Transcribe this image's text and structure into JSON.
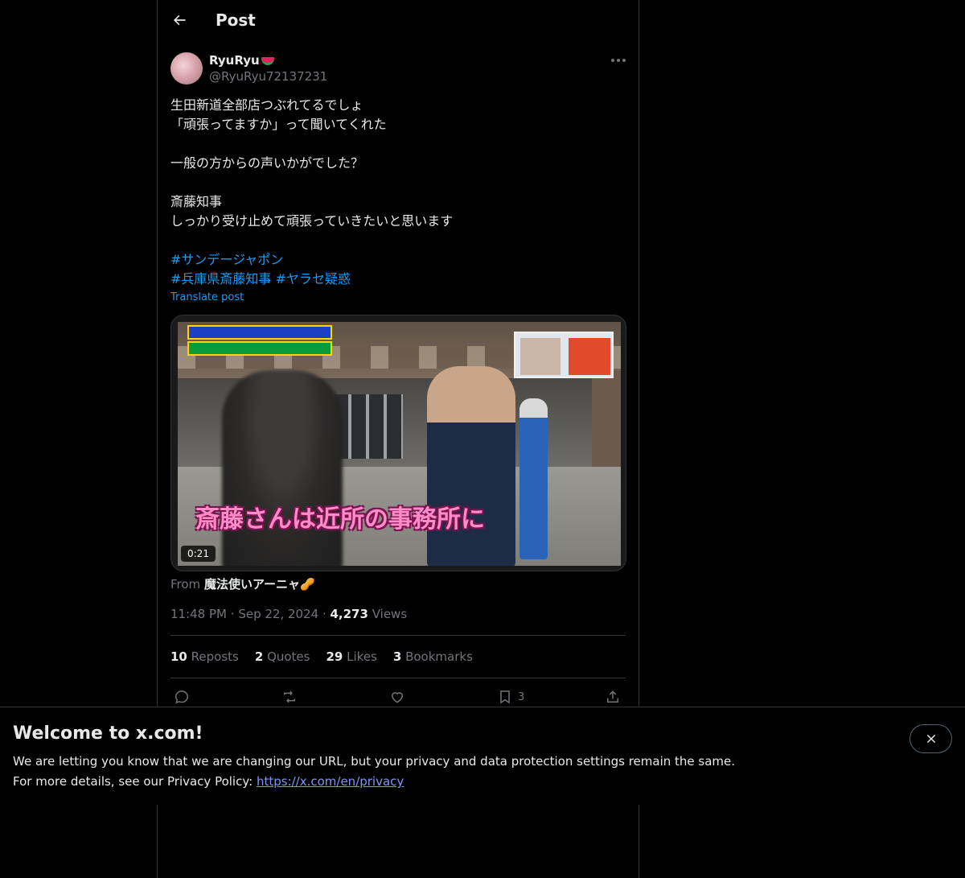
{
  "header": {
    "title": "Post"
  },
  "author": {
    "display_name": "RyuRyu",
    "handle": "@RyuRyu72137231"
  },
  "post": {
    "lines": [
      "生田新道全部店つぶれてるでしょ",
      "「頑張ってますか」って聞いてくれた",
      "",
      "一般の方からの声いかがでした？",
      "",
      "斎藤知事",
      "しっかり受け止めて頑張っていきたいと思います"
    ],
    "hashtags": {
      "row1": [
        "#サンデージャポン"
      ],
      "row2": [
        "#兵庫県斎藤知事",
        "#ヤラセ疑惑"
      ]
    },
    "translate_label": "Translate post"
  },
  "media": {
    "caption": "斎藤さんは近所の事務所に",
    "duration": "0:21"
  },
  "from": {
    "label": "From",
    "name": "魔法使いアーニャ🥜"
  },
  "meta": {
    "time": "11:48 PM",
    "date": "Sep 22, 2024",
    "views_count": "4,273",
    "views_label": "Views"
  },
  "stats": {
    "reposts": {
      "count": "10",
      "label": "Reposts"
    },
    "quotes": {
      "count": "2",
      "label": "Quotes"
    },
    "likes": {
      "count": "29",
      "label": "Likes"
    },
    "bookmarks": {
      "count": "3",
      "label": "Bookmarks"
    }
  },
  "actions": {
    "reply_icon": "reply-icon",
    "repost_icon": "repost-icon",
    "like_icon": "heart-icon",
    "bookmark_icon": "bookmark-icon",
    "bookmark_count": "3",
    "share_icon": "share-icon"
  },
  "banner": {
    "title": "Welcome to x.com!",
    "line1": "We are letting you know that we are changing our URL, but your privacy and data protection settings remain the same.",
    "line2_prefix": "For more details, see our Privacy Policy: ",
    "link": "https://x.com/en/privacy"
  },
  "colors": {
    "background": "#000000",
    "text_primary": "#e7e9ea",
    "text_secondary": "#71767b",
    "accent": "#1d9bf0",
    "border": "#2f3336"
  }
}
